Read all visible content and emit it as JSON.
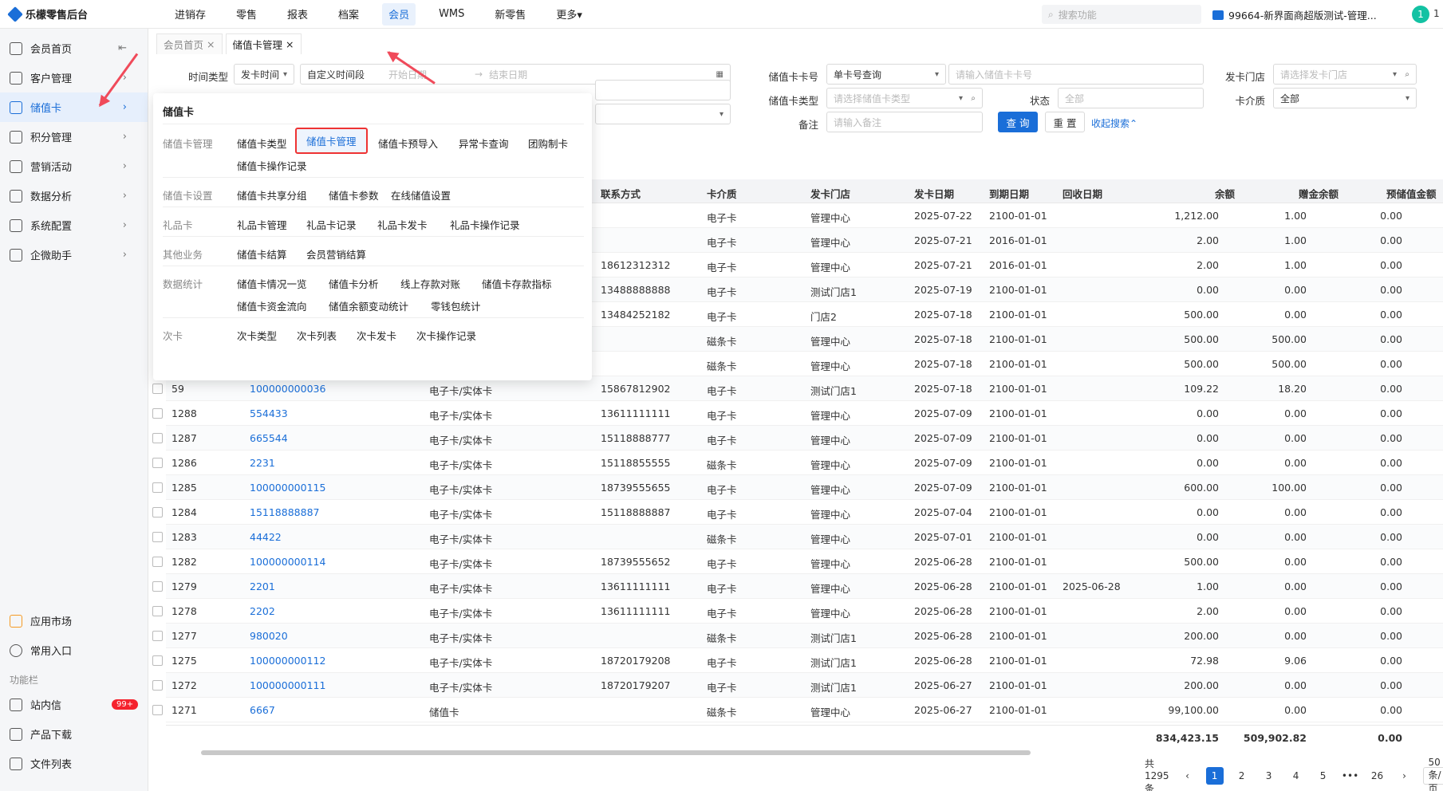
{
  "app": {
    "title": "乐檬零售后台"
  },
  "topnav": [
    "进销存",
    "零售",
    "报表",
    "档案",
    "会员",
    "WMS",
    "新零售",
    "更多▾"
  ],
  "topnav_active": "会员",
  "search": {
    "placeholder": "搜索功能"
  },
  "store": {
    "label": "99664-新界面商超版测试-管理..."
  },
  "user": {
    "avatar": "1",
    "num": "1"
  },
  "sidebar": {
    "items": [
      "会员首页",
      "客户管理",
      "储值卡",
      "积分管理",
      "营销活动",
      "数据分析",
      "系统配置",
      "企微助手"
    ],
    "active": "储值卡",
    "bottom": [
      "应用市场",
      "常用入口"
    ],
    "section": "功能栏",
    "func": [
      "站内信",
      "产品下载",
      "文件列表"
    ],
    "badge": "99+"
  },
  "tabs": [
    {
      "label": "会员首页"
    },
    {
      "label": "储值卡管理"
    }
  ],
  "filters": {
    "time_type_label": "时间类型",
    "time_type_value": "发卡时间",
    "time_range_value": "自定义时间段",
    "start_ph": "开始日期",
    "end_ph": "结束日期",
    "card_no_label": "储值卡卡号",
    "card_no_mode": "单卡号查询",
    "card_no_ph": "请输入储值卡卡号",
    "store_label": "发卡门店",
    "store_ph": "请选择发卡门店",
    "card_type_label": "储值卡类型",
    "card_type_ph": "请选择储值卡类型",
    "status_label": "状态",
    "status_value": "全部",
    "medium_label": "卡介质",
    "medium_value": "全部",
    "remark_label": "备注",
    "remark_ph": "请输入备注",
    "query": "查 询",
    "reset": "重 置",
    "collapse": "收起搜索⌃"
  },
  "table": {
    "headers": [
      "联系方式",
      "卡介质",
      "发卡门店",
      "发卡日期",
      "到期日期",
      "回收日期",
      "余额",
      "赠金余额",
      "预储值金额"
    ],
    "rows": [
      {
        "id": "",
        "card": "",
        "type": "",
        "phone": "",
        "medium": "电子卡",
        "store": "管理中心",
        "issue": "2025-07-22",
        "expire": "2100-01-01",
        "recycle": "",
        "balance": "1,212.00",
        "bonus": "1.00",
        "pre": "0.00"
      },
      {
        "id": "",
        "card": "",
        "type": "",
        "phone": "",
        "medium": "电子卡",
        "store": "管理中心",
        "issue": "2025-07-21",
        "expire": "2016-01-01",
        "recycle": "",
        "balance": "2.00",
        "bonus": "1.00",
        "pre": "0.00"
      },
      {
        "id": "",
        "card": "",
        "type": "",
        "phone": "18612312312",
        "medium": "电子卡",
        "store": "管理中心",
        "issue": "2025-07-21",
        "expire": "2016-01-01",
        "recycle": "",
        "balance": "2.00",
        "bonus": "1.00",
        "pre": "0.00"
      },
      {
        "id": "",
        "card": "",
        "type": "",
        "phone": "13488888888",
        "medium": "电子卡",
        "store": "测试门店1",
        "issue": "2025-07-19",
        "expire": "2100-01-01",
        "recycle": "",
        "balance": "0.00",
        "bonus": "0.00",
        "pre": "0.00"
      },
      {
        "id": "",
        "card": "",
        "type": "",
        "phone": "13484252182",
        "medium": "电子卡",
        "store": "门店2",
        "issue": "2025-07-18",
        "expire": "2100-01-01",
        "recycle": "",
        "balance": "500.00",
        "bonus": "0.00",
        "pre": "0.00"
      },
      {
        "id": "",
        "card": "",
        "type": "",
        "phone": "",
        "medium": "磁条卡",
        "store": "管理中心",
        "issue": "2025-07-18",
        "expire": "2100-01-01",
        "recycle": "",
        "balance": "500.00",
        "bonus": "500.00",
        "pre": "0.00"
      },
      {
        "id": "",
        "card": "",
        "type": "",
        "phone": "",
        "medium": "磁条卡",
        "store": "管理中心",
        "issue": "2025-07-18",
        "expire": "2100-01-01",
        "recycle": "",
        "balance": "500.00",
        "bonus": "500.00",
        "pre": "0.00"
      },
      {
        "id": "59",
        "card": "100000000036",
        "type": "电子卡/实体卡",
        "phone": "15867812902",
        "medium": "电子卡",
        "store": "测试门店1",
        "issue": "2025-07-18",
        "expire": "2100-01-01",
        "recycle": "",
        "balance": "109.22",
        "bonus": "18.20",
        "pre": "0.00"
      },
      {
        "id": "1288",
        "card": "554433",
        "type": "电子卡/实体卡",
        "phone": "13611111111",
        "medium": "电子卡",
        "store": "管理中心",
        "issue": "2025-07-09",
        "expire": "2100-01-01",
        "recycle": "",
        "balance": "0.00",
        "bonus": "0.00",
        "pre": "0.00"
      },
      {
        "id": "1287",
        "card": "665544",
        "type": "电子卡/实体卡",
        "phone": "15118888777",
        "medium": "电子卡",
        "store": "管理中心",
        "issue": "2025-07-09",
        "expire": "2100-01-01",
        "recycle": "",
        "balance": "0.00",
        "bonus": "0.00",
        "pre": "0.00"
      },
      {
        "id": "1286",
        "card": "2231",
        "type": "电子卡/实体卡",
        "phone": "15118855555",
        "medium": "磁条卡",
        "store": "管理中心",
        "issue": "2025-07-09",
        "expire": "2100-01-01",
        "recycle": "",
        "balance": "0.00",
        "bonus": "0.00",
        "pre": "0.00"
      },
      {
        "id": "1285",
        "card": "100000000115",
        "type": "电子卡/实体卡",
        "phone": "18739555655",
        "medium": "电子卡",
        "store": "管理中心",
        "issue": "2025-07-09",
        "expire": "2100-01-01",
        "recycle": "",
        "balance": "600.00",
        "bonus": "100.00",
        "pre": "0.00"
      },
      {
        "id": "1284",
        "card": "15118888887",
        "type": "电子卡/实体卡",
        "phone": "15118888887",
        "medium": "电子卡",
        "store": "管理中心",
        "issue": "2025-07-04",
        "expire": "2100-01-01",
        "recycle": "",
        "balance": "0.00",
        "bonus": "0.00",
        "pre": "0.00"
      },
      {
        "id": "1283",
        "card": "44422",
        "type": "电子卡/实体卡",
        "phone": "",
        "medium": "磁条卡",
        "store": "管理中心",
        "issue": "2025-07-01",
        "expire": "2100-01-01",
        "recycle": "",
        "balance": "0.00",
        "bonus": "0.00",
        "pre": "0.00"
      },
      {
        "id": "1282",
        "card": "100000000114",
        "type": "电子卡/实体卡",
        "phone": "18739555652",
        "medium": "电子卡",
        "store": "管理中心",
        "issue": "2025-06-28",
        "expire": "2100-01-01",
        "recycle": "",
        "balance": "500.00",
        "bonus": "0.00",
        "pre": "0.00"
      },
      {
        "id": "1279",
        "card": "2201",
        "type": "电子卡/实体卡",
        "phone": "13611111111",
        "medium": "电子卡",
        "store": "管理中心",
        "issue": "2025-06-28",
        "expire": "2100-01-01",
        "recycle": "2025-06-28",
        "balance": "1.00",
        "bonus": "0.00",
        "pre": "0.00"
      },
      {
        "id": "1278",
        "card": "2202",
        "type": "电子卡/实体卡",
        "phone": "13611111111",
        "medium": "电子卡",
        "store": "管理中心",
        "issue": "2025-06-28",
        "expire": "2100-01-01",
        "recycle": "",
        "balance": "2.00",
        "bonus": "0.00",
        "pre": "0.00"
      },
      {
        "id": "1277",
        "card": "980020",
        "type": "电子卡/实体卡",
        "phone": "",
        "medium": "磁条卡",
        "store": "测试门店1",
        "issue": "2025-06-28",
        "expire": "2100-01-01",
        "recycle": "",
        "balance": "200.00",
        "bonus": "0.00",
        "pre": "0.00"
      },
      {
        "id": "1275",
        "card": "100000000112",
        "type": "电子卡/实体卡",
        "phone": "18720179208",
        "medium": "电子卡",
        "store": "测试门店1",
        "issue": "2025-06-28",
        "expire": "2100-01-01",
        "recycle": "",
        "balance": "72.98",
        "bonus": "9.06",
        "pre": "0.00"
      },
      {
        "id": "1272",
        "card": "100000000111",
        "type": "电子卡/实体卡",
        "phone": "18720179207",
        "medium": "电子卡",
        "store": "测试门店1",
        "issue": "2025-06-27",
        "expire": "2100-01-01",
        "recycle": "",
        "balance": "200.00",
        "bonus": "0.00",
        "pre": "0.00"
      },
      {
        "id": "1271",
        "card": "6667",
        "type": "储值卡",
        "phone": "",
        "medium": "磁条卡",
        "store": "管理中心",
        "issue": "2025-06-27",
        "expire": "2100-01-01",
        "recycle": "",
        "balance": "99,100.00",
        "bonus": "0.00",
        "pre": "0.00"
      }
    ],
    "totals": {
      "balance": "834,423.15",
      "bonus": "509,902.82",
      "pre": "0.00"
    }
  },
  "pager": {
    "total": "共1295条",
    "pages": [
      "1",
      "2",
      "3",
      "4",
      "5",
      "•••",
      "26"
    ],
    "size": "50 条/页"
  },
  "dropdown": {
    "title": "储值卡",
    "sections": [
      {
        "name": "储值卡管理",
        "items": [
          "储值卡类型",
          "储值卡管理",
          "储值卡预导入",
          "异常卡查询",
          "团购制卡",
          "储值卡操作记录"
        ]
      },
      {
        "name": "储值卡设置",
        "items": [
          "储值卡共享分组",
          "储值卡参数",
          "在线储值设置"
        ]
      },
      {
        "name": "礼品卡",
        "items": [
          "礼品卡管理",
          "礼品卡记录",
          "礼品卡发卡",
          "礼品卡操作记录"
        ]
      },
      {
        "name": "其他业务",
        "items": [
          "储值卡结算",
          "会员营销结算"
        ]
      },
      {
        "name": "数据统计",
        "items": [
          "储值卡情况一览",
          "储值卡分析",
          "线上存款对账",
          "储值卡存款指标",
          "储值卡资金流向",
          "储值余额变动统计",
          "零钱包统计"
        ]
      },
      {
        "name": "次卡",
        "items": [
          "次卡类型",
          "次卡列表",
          "次卡发卡",
          "次卡操作记录"
        ]
      }
    ]
  }
}
